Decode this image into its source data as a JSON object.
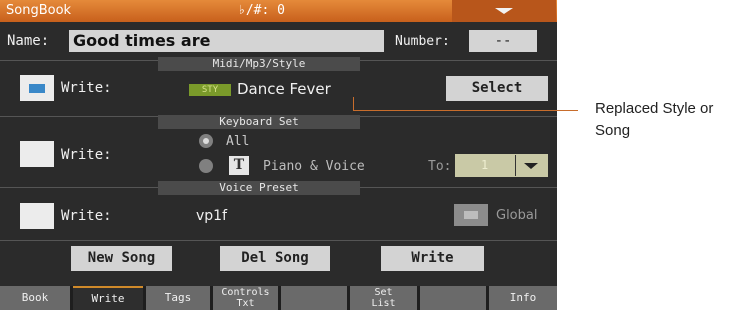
{
  "titlebar": {
    "app": "SongBook",
    "accidental": "♭/#: 0"
  },
  "header": {
    "name_label": "Name:",
    "name_value": "Good times are",
    "number_label": "Number:",
    "number_value": "--"
  },
  "sections": {
    "midi": {
      "title": "Midi/Mp3/Style",
      "write_label": "Write:",
      "write_checked": true,
      "badge": "STY",
      "item": "Dance Fever",
      "select_label": "Select"
    },
    "keyboard": {
      "title": "Keyboard Set",
      "write_label": "Write:",
      "write_checked": false,
      "opt_all": "All",
      "opt_piano": "Piano & Voice",
      "t_icon": "T",
      "to_label": "To:",
      "to_value": "1"
    },
    "voice": {
      "title": "Voice Preset",
      "write_label": "Write:",
      "write_checked": false,
      "value": "vp1f",
      "global_label": "Global"
    }
  },
  "buttons": {
    "new_song": "New Song",
    "del_song": "Del Song",
    "write": "Write"
  },
  "tabs": {
    "book": "Book",
    "write": "Write",
    "tags": "Tags",
    "controls_1": "Controls",
    "controls_2": "Txt",
    "set_1": "Set",
    "set_2": "List",
    "info": "Info"
  },
  "annotation": {
    "line1": "Replaced Style or",
    "line2": "Song"
  },
  "colors": {
    "accent": "#d0782a",
    "checked": "#3a88c8",
    "badge": "#7a9a2a"
  }
}
